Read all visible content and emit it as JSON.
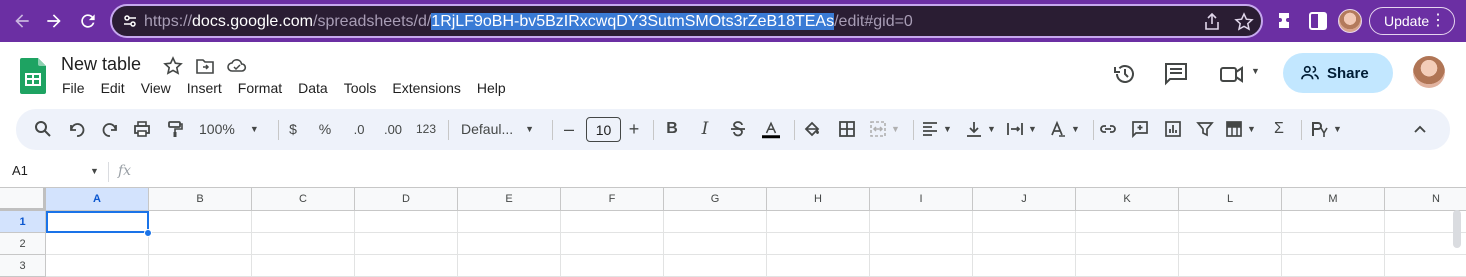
{
  "browser": {
    "url_prefix": "https://",
    "url_host": "docs.google.com",
    "url_path": "/spreadsheets/d/",
    "url_selected": "1RjLF9oBH-bv5BzIRxcwqDY3SutmSMOts3rZeB18TEAs",
    "url_suffix": "/edit#gid=0",
    "update_label": "Update",
    "accent_color": "#6b2fa3"
  },
  "doc": {
    "title": "New table",
    "menu": [
      "File",
      "Edit",
      "View",
      "Insert",
      "Format",
      "Data",
      "Tools",
      "Extensions",
      "Help"
    ],
    "share_label": "Share"
  },
  "toolbar": {
    "zoom": "100%",
    "currency": "$",
    "percent": "%",
    "decrease_decimal": ".0",
    "increase_decimal": ".00",
    "number_format": "123",
    "font": "Defaul...",
    "font_size": "10",
    "minus": "–",
    "plus": "+",
    "bold": "B",
    "italic": "I",
    "sum": "Σ"
  },
  "formula_bar": {
    "name_box": "A1",
    "fx_label": "fx"
  },
  "grid": {
    "columns": [
      "A",
      "B",
      "C",
      "D",
      "E",
      "F",
      "G",
      "H",
      "I",
      "J",
      "K",
      "L",
      "M",
      "N"
    ],
    "rows": [
      "1",
      "2",
      "3"
    ],
    "selected_cell": "A1"
  }
}
